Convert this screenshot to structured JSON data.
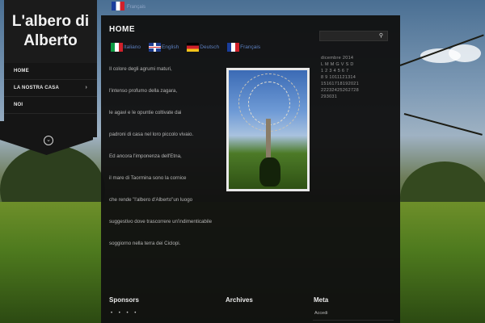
{
  "top_bar": {
    "flag_label": "Français"
  },
  "sidebar": {
    "title_line1": "L'albero di",
    "title_line2": "Alberto",
    "nav": [
      {
        "label": "HOME",
        "has_submenu": false
      },
      {
        "label": "LA NOSTRA CASA",
        "has_submenu": true
      },
      {
        "label": "NOI",
        "has_submenu": false
      }
    ],
    "submenu_chevron": "›",
    "expand_icon": "⌄"
  },
  "main": {
    "title": "HOME",
    "languages": [
      {
        "label": "Italiano",
        "flag": "it"
      },
      {
        "label": "English",
        "flag": "uk"
      },
      {
        "label": "Deutsch",
        "flag": "de"
      },
      {
        "label": "Français",
        "flag": "fr"
      }
    ],
    "poem": [
      "Il colore degli agrumi maturi,",
      "l'intenso profumo della zagara,",
      "le agavi e le opuntie coltivate dai",
      "padroni di casa nel loro piccolo vivaio.",
      "Ed ancora l'imponenza dell'Etna,",
      "il mare di Taormina sono la cornice",
      "che rende \"l'albero d'Alberto\"un luogo",
      "suggestivo dove trascorrere un'indimenticabile",
      "soggiorno nella terra dei Ciclopi."
    ]
  },
  "widgets": {
    "sponsors_title": "Sponsors",
    "sponsors_dots": "• • • •",
    "archives_title": "Archives",
    "meta_title": "Meta",
    "meta_link": "Accedi",
    "search_icon": "⚲",
    "calendar": {
      "month": "dicembre  2014",
      "header": "L M M G V S D",
      "rows": [
        "1 2 3 4 5 6 7",
        "8 9 1011121314",
        "15161718192021",
        "22232425262728",
        "293031"
      ]
    }
  },
  "colors": {
    "panel": "#111111",
    "sidebar": "#151515",
    "link": "#5c7fbf",
    "text": "#b6b6b6"
  }
}
